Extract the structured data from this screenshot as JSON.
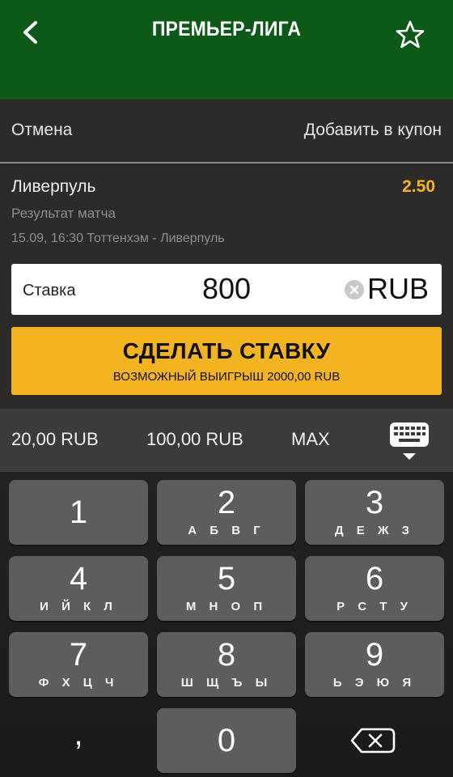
{
  "header": {
    "title": "ПРЕМЬЕР-ЛИГА",
    "back_icon": "chevron-left-icon",
    "favorite_icon": "star-outline-icon"
  },
  "actions": {
    "cancel": "Отмена",
    "add_to_coupon": "Добавить в купон"
  },
  "selection": {
    "name": "Ливерпуль",
    "odds": "2.50",
    "market": "Результат матча",
    "match": "15.09, 16:30 Тоттенхэм - Ливерпуль"
  },
  "stake": {
    "label": "Ставка",
    "value": "800",
    "currency": "RUB"
  },
  "bet_button": {
    "title": "СДЕЛАТЬ СТАВКУ",
    "subtitle": "ВОЗМОЖНЫЙ ВЫИГРЫШ 2000,00 RUB"
  },
  "quick_amounts": [
    "20,00 RUB",
    "100,00 RUB",
    "MAX"
  ],
  "keypad": {
    "keys": [
      {
        "num": "1",
        "letters": ""
      },
      {
        "num": "2",
        "letters": "А Б В Г"
      },
      {
        "num": "3",
        "letters": "Д Е Ж З"
      },
      {
        "num": "4",
        "letters": "И Й К Л"
      },
      {
        "num": "5",
        "letters": "М Н О П"
      },
      {
        "num": "6",
        "letters": "Р С Т У"
      },
      {
        "num": "7",
        "letters": "Ф Х Ц Ч"
      },
      {
        "num": "8",
        "letters": "Ш Щ Ъ Ы"
      },
      {
        "num": "9",
        "letters": "Ь Э Ю Я"
      }
    ],
    "comma": ",",
    "zero": "0"
  },
  "colors": {
    "header": "#0d5a18",
    "accent": "#f4b321",
    "background": "#2d2b29"
  }
}
